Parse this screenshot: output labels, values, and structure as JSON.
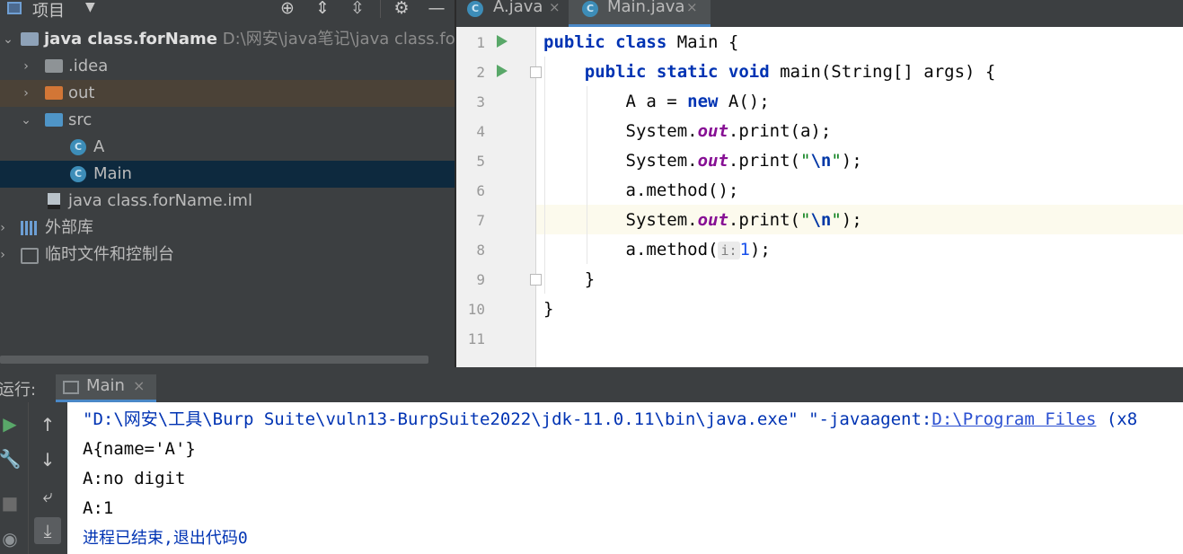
{
  "project_panel": {
    "title": "项目",
    "tree": [
      {
        "label": "java class.forName",
        "path": "D:\\网安\\java笔记\\java class.forName"
      },
      {
        "label": ".idea"
      },
      {
        "label": "out"
      },
      {
        "label": "src"
      },
      {
        "label": "A"
      },
      {
        "label": "Main"
      },
      {
        "label": "java class.forName.iml"
      },
      {
        "label": "外部库"
      },
      {
        "label": "临时文件和控制台"
      }
    ]
  },
  "editor": {
    "tabs": [
      {
        "label": "A.java",
        "close": "×"
      },
      {
        "label": "Main.java",
        "close": "×"
      }
    ],
    "line_numbers": [
      "1",
      "2",
      "3",
      "4",
      "5",
      "6",
      "7",
      "8",
      "9",
      "10",
      "11"
    ],
    "code": {
      "l1_kw": "public class",
      "l1_rest": " Main {",
      "l2_indent": "    ",
      "l2_kw": "public static void",
      "l2_rest": " main(String[] args) {",
      "l3_pre": "        A a = ",
      "l3_kw": "new",
      "l3_post": " A();",
      "l4_pre": "        System.",
      "l4_fld": "out",
      "l4_post": ".print(a);",
      "l5_pre": "        System.",
      "l5_fld": "out",
      "l5_mid": ".print(",
      "l5_q1": "\"",
      "l5_esc": "\\n",
      "l5_q2": "\"",
      "l5_post": ");",
      "l6": "        a.method();",
      "l7_pre": "        System.",
      "l7_fld": "out",
      "l7_mid": ".print(",
      "l7_q1": "\"",
      "l7_esc": "\\n",
      "l7_q2": "\"",
      "l7_post": ");",
      "l8_pre": "        a.method(",
      "l8_hint": "i:",
      "l8_num": "1",
      "l8_post": ");",
      "l9": "    }",
      "l10": "}"
    }
  },
  "run_panel": {
    "label": "运行:",
    "tab_label": "Main",
    "tab_close": "×",
    "console": {
      "cmd_pre": "\"D:\\网安\\工具\\Burp Suite\\vuln13-BurpSuite2022\\jdk-11.0.11\\bin\\java.exe\" \"-javaagent:",
      "cmd_link": "D:\\Program Files",
      "cmd_post": " (x8",
      "out1": "A{name='A'}",
      "out2": "A:no digit",
      "out3": "A:1",
      "exit": "进程已结束,退出代码0"
    }
  },
  "colors": {
    "ide_background": "#3c3f41",
    "selection": "#0d293e",
    "keyword": "#0033b3",
    "static_field": "#871094",
    "run_green": "#59a869",
    "tab_underline": "#4a88c7"
  }
}
